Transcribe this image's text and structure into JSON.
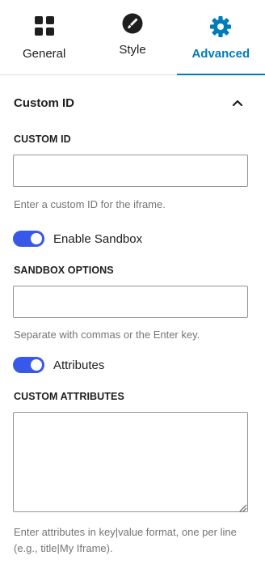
{
  "tabs": [
    {
      "label": "General",
      "icon": "grid-icon"
    },
    {
      "label": "Style",
      "icon": "brush-icon"
    },
    {
      "label": "Advanced",
      "icon": "gear-icon"
    }
  ],
  "active_tab": "Advanced",
  "accent_color": "#007cba",
  "toggle_color": "#3858e9",
  "section": {
    "title": "Custom ID",
    "expanded": true
  },
  "custom_id": {
    "label": "CUSTOM ID",
    "value": "",
    "help": "Enter a custom ID for the iframe."
  },
  "sandbox_toggle": {
    "label": "Enable Sandbox",
    "checked": true
  },
  "sandbox_options": {
    "label": "SANDBOX OPTIONS",
    "value": "",
    "help": "Separate with commas or the Enter key."
  },
  "attributes_toggle": {
    "label": "Attributes",
    "checked": true
  },
  "custom_attributes": {
    "label": "CUSTOM ATTRIBUTES",
    "value": "",
    "help": "Enter attributes in key|value format, one per line (e.g., title|My Iframe)."
  }
}
